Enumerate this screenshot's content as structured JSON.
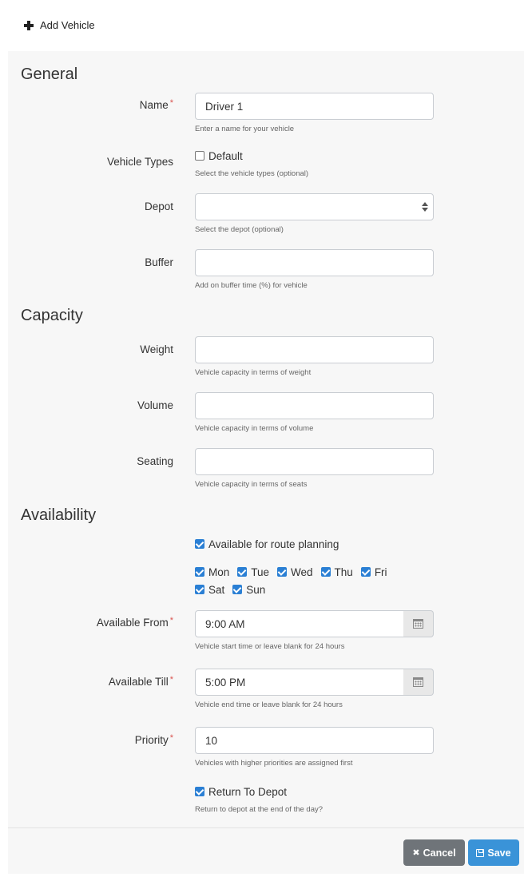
{
  "header": {
    "title": "Add Vehicle"
  },
  "sections": {
    "general": "General",
    "capacity": "Capacity",
    "availability": "Availability"
  },
  "fields": {
    "name": {
      "label": "Name",
      "value": "Driver 1",
      "help": "Enter a name for your vehicle"
    },
    "vehicle_types": {
      "label": "Vehicle Types",
      "option": "Default",
      "help": "Select the vehicle types (optional)"
    },
    "depot": {
      "label": "Depot",
      "value": "",
      "help": "Select the depot (optional)"
    },
    "buffer": {
      "label": "Buffer",
      "value": "",
      "help": "Add on buffer time (%) for vehicle"
    },
    "weight": {
      "label": "Weight",
      "value": "",
      "help": "Vehicle capacity in terms of weight"
    },
    "volume": {
      "label": "Volume",
      "value": "",
      "help": "Vehicle capacity in terms of volume"
    },
    "seating": {
      "label": "Seating",
      "value": "",
      "help": "Vehicle capacity in terms of seats"
    },
    "available_for_planning": {
      "label": "Available for route planning",
      "checked": true
    },
    "days": [
      "Mon",
      "Tue",
      "Wed",
      "Thu",
      "Fri",
      "Sat",
      "Sun"
    ],
    "available_from": {
      "label": "Available From",
      "value": "9:00 AM",
      "help": "Vehicle start time or leave blank for 24 hours"
    },
    "available_till": {
      "label": "Available Till",
      "value": "5:00 PM",
      "help": "Vehicle end time or leave blank for 24 hours"
    },
    "priority": {
      "label": "Priority",
      "value": "10",
      "help": "Vehicles with higher priorities are assigned first"
    },
    "return_to_depot": {
      "label": "Return To Depot",
      "checked": true,
      "help": "Return to depot at the end of the day?"
    }
  },
  "buttons": {
    "cancel": "Cancel",
    "save": "Save"
  },
  "icons": {
    "add": "plus-icon",
    "calendar": "calendar-icon",
    "cancel": "times-icon",
    "save": "floppy-disk-icon"
  },
  "colors": {
    "accent": "#2a7fd4",
    "required": "#d9534f",
    "cancel_bg": "#6f7479",
    "save_bg": "#3a93d8"
  }
}
